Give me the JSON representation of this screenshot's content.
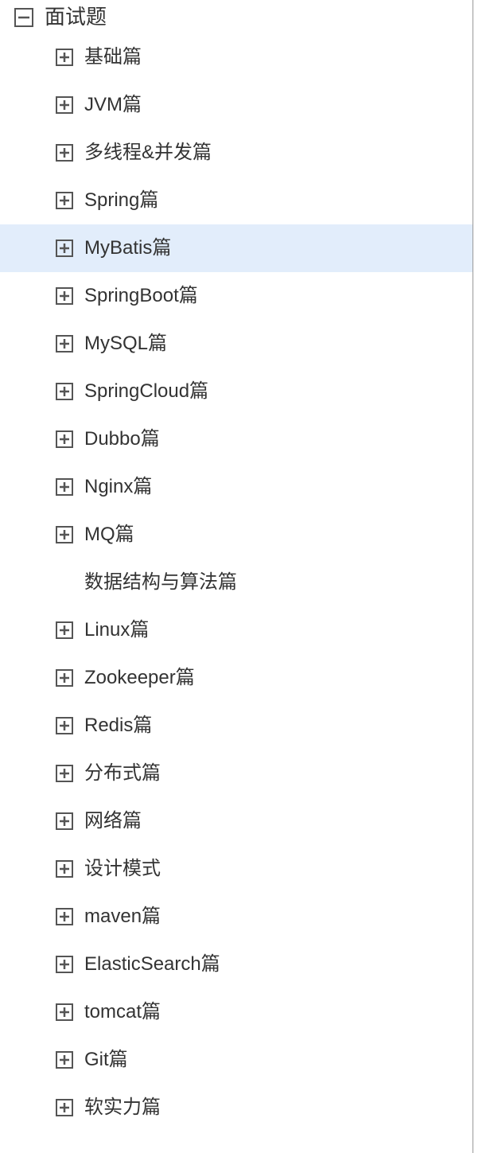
{
  "tree": {
    "root": {
      "label": "面试题",
      "expanded": true
    },
    "children": [
      {
        "label": "基础篇",
        "hasToggle": true,
        "selected": false
      },
      {
        "label": "JVM篇",
        "hasToggle": true,
        "selected": false
      },
      {
        "label": "多线程&并发篇",
        "hasToggle": true,
        "selected": false
      },
      {
        "label": "Spring篇",
        "hasToggle": true,
        "selected": false
      },
      {
        "label": "MyBatis篇",
        "hasToggle": true,
        "selected": true
      },
      {
        "label": "SpringBoot篇",
        "hasToggle": true,
        "selected": false
      },
      {
        "label": "MySQL篇",
        "hasToggle": true,
        "selected": false
      },
      {
        "label": "SpringCloud篇",
        "hasToggle": true,
        "selected": false
      },
      {
        "label": "Dubbo篇",
        "hasToggle": true,
        "selected": false
      },
      {
        "label": "Nginx篇",
        "hasToggle": true,
        "selected": false
      },
      {
        "label": "MQ篇",
        "hasToggle": true,
        "selected": false
      },
      {
        "label": "数据结构与算法篇",
        "hasToggle": false,
        "selected": false
      },
      {
        "label": "Linux篇",
        "hasToggle": true,
        "selected": false
      },
      {
        "label": "Zookeeper篇",
        "hasToggle": true,
        "selected": false
      },
      {
        "label": "Redis篇",
        "hasToggle": true,
        "selected": false
      },
      {
        "label": "分布式篇",
        "hasToggle": true,
        "selected": false
      },
      {
        "label": "网络篇",
        "hasToggle": true,
        "selected": false
      },
      {
        "label": "设计模式",
        "hasToggle": true,
        "selected": false
      },
      {
        "label": "maven篇",
        "hasToggle": true,
        "selected": false
      },
      {
        "label": "ElasticSearch篇",
        "hasToggle": true,
        "selected": false
      },
      {
        "label": "tomcat篇",
        "hasToggle": true,
        "selected": false
      },
      {
        "label": "Git篇",
        "hasToggle": true,
        "selected": false
      },
      {
        "label": "软实力篇",
        "hasToggle": true,
        "selected": false
      }
    ]
  }
}
